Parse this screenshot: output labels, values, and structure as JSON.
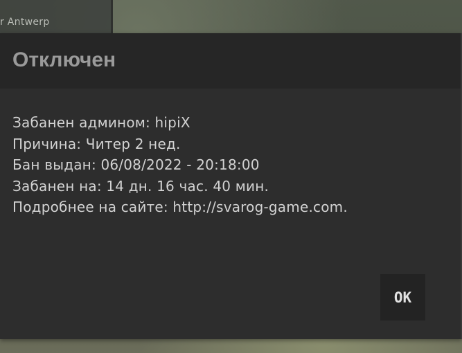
{
  "background": {
    "server_label": "r Antwerp"
  },
  "dialog": {
    "title": "Отключен",
    "lines": [
      "Забанен админом: hipiX",
      "Причина: Читер 2 нед.",
      "Бан выдан: 06/08/2022 - 20:18:00",
      "Забанен на: 14 дн. 16 час. 40 мин.",
      "Подробнее на сайте: http://svarog-game.com."
    ],
    "ok_label": "OK"
  }
}
